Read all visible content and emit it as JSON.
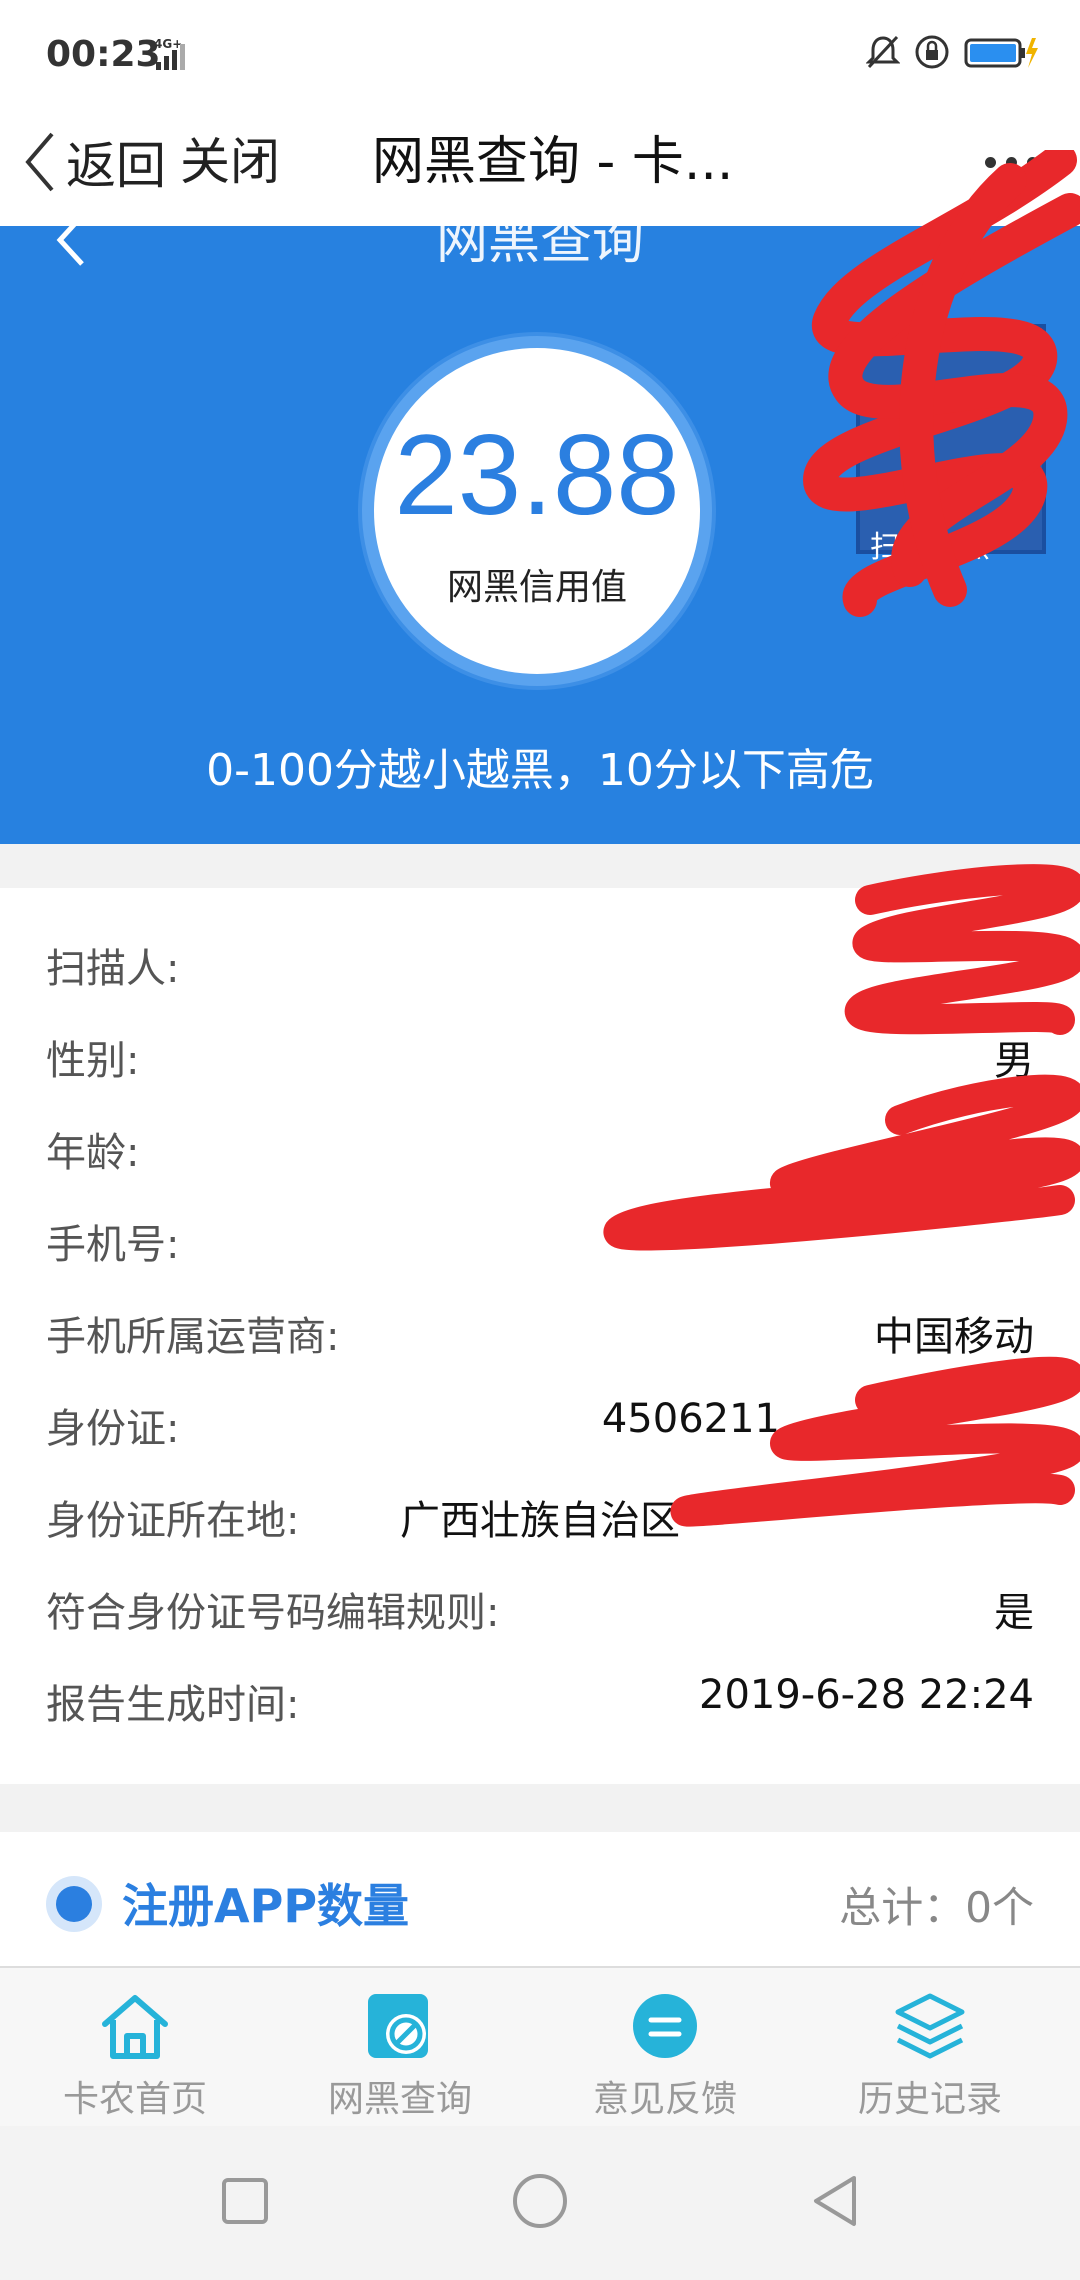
{
  "status_bar": {
    "time": "00:23",
    "network": "4G+",
    "battery_color": "#2a8ff0",
    "charging_color": "#f0b400"
  },
  "nav": {
    "back_label": "返回",
    "close_label": "关闭",
    "title": "网黑查询 - 卡..."
  },
  "hero": {
    "title": "网黑查询",
    "score": "23.88",
    "score_label": "网黑信用值",
    "qr_caption": "扫码查黑",
    "hint": "0-100分越小越黑，10分以下高危",
    "background_color": "#2781e0"
  },
  "info": {
    "rows": [
      {
        "label": "扫描人:",
        "value": ""
      },
      {
        "label": "性别:",
        "value": "男"
      },
      {
        "label": "年龄:",
        "value": ""
      },
      {
        "label": "手机号:",
        "value": ""
      },
      {
        "label": "手机所属运营商:",
        "value": "中国移动"
      },
      {
        "label": "身份证:",
        "value": "4506211"
      },
      {
        "label": "身份证所在地:",
        "value": "广西壮族自治区"
      },
      {
        "label": "符合身份证号码编辑规则:",
        "value": "是"
      },
      {
        "label": "报告生成时间:",
        "value": "2019-6-28 22:24"
      }
    ]
  },
  "app_section": {
    "title": "注册APP数量",
    "total": "总计：0个",
    "accent_color": "#2b7fe0"
  },
  "tabs": [
    {
      "label": "卡农首页",
      "icon": "home-icon"
    },
    {
      "label": "网黑查询",
      "icon": "blacklist-search-icon"
    },
    {
      "label": "意见反馈",
      "icon": "feedback-icon"
    },
    {
      "label": "历史记录",
      "icon": "history-layers-icon"
    }
  ],
  "redaction_color": "#e8282b"
}
